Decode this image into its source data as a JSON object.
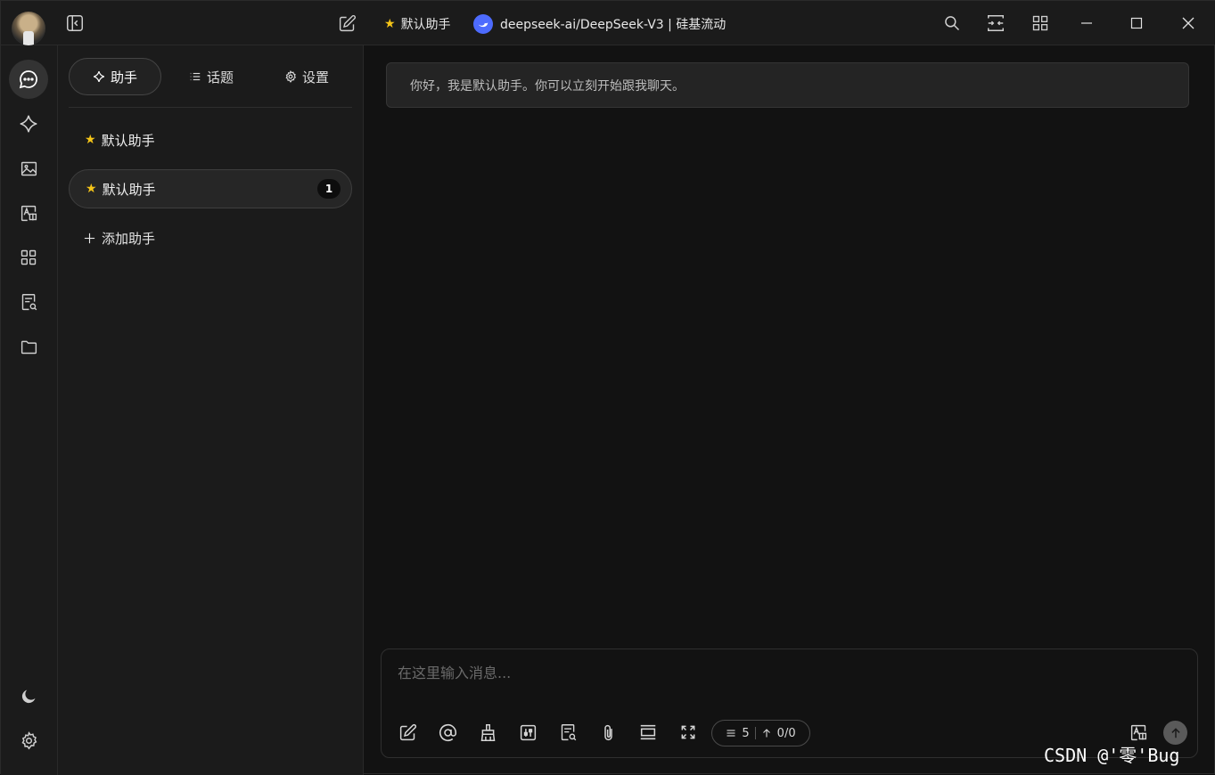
{
  "titlebar": {
    "assistant_name": "默认助手",
    "model_name": "deepseek-ai/DeepSeek-V3 | 硅基流动"
  },
  "panel": {
    "tabs": [
      {
        "label": "助手",
        "icon": "sparkle-icon",
        "active": true
      },
      {
        "label": "话题",
        "icon": "list-icon",
        "active": false
      },
      {
        "label": "设置",
        "icon": "gear-icon",
        "active": false
      }
    ],
    "assistants": [
      {
        "label": "默认助手",
        "selected": false
      },
      {
        "label": "默认助手",
        "selected": true,
        "count": "1"
      }
    ],
    "add_label": "添加助手"
  },
  "chat": {
    "greeting": "你好，我是默认助手。你可以立刻开始跟我聊天。"
  },
  "composer": {
    "placeholder": "在这里输入消息...",
    "context_count": "5",
    "token_usage": "0/0"
  },
  "watermark": "CSDN @'零'Bug",
  "colors": {
    "accent_star": "#f5c518",
    "model_badge": "#4d6bfe",
    "background": "#121212",
    "panel": "#1b1b1b"
  }
}
